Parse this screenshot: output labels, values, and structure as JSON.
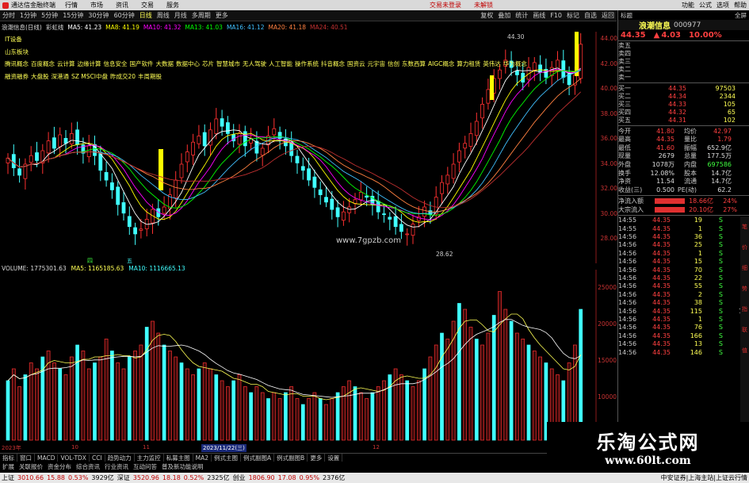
{
  "menubar": {
    "app_title": "通达信金融终端",
    "items": [
      "行情",
      "市场",
      "资讯",
      "交易",
      "服务"
    ],
    "alerts": [
      "交易未登录",
      "未解锁"
    ],
    "right_items": [
      "功能",
      "公式",
      "选项",
      "帮助"
    ]
  },
  "toolbar": {
    "items": [
      "分时",
      "1分钟",
      "5分钟",
      "15分钟",
      "30分钟",
      "60分钟",
      "日线",
      "周线",
      "月线",
      "多周期",
      "更多"
    ],
    "active": "日线",
    "tools": [
      "复权",
      "叠加",
      "统计",
      "画线",
      "F10",
      "标记",
      "自选",
      "返回"
    ]
  },
  "chart_header": {
    "stock": "浪潮信息(日线)",
    "indicator": "彩虹线",
    "ma": [
      {
        "label": "MA5: 41.23",
        "color": "#ffffff"
      },
      {
        "label": "MA8: 41.19",
        "color": "#ffff00"
      },
      {
        "label": "MA10: 41.32",
        "color": "#ff00ff"
      },
      {
        "label": "MA13: 41.03",
        "color": "#00ff00"
      },
      {
        "label": "MA16: 41.12",
        "color": "#40c0ff"
      },
      {
        "label": "MA20: 41.18",
        "color": "#ff8040"
      },
      {
        "label": "MA24: 40.51",
        "color": "#c03030"
      }
    ]
  },
  "concepts": [
    [
      "IT设备"
    ],
    [
      "山东板块"
    ],
    [
      "腾讯概念",
      "百度概念",
      "云计算",
      "边缘计算",
      "信息安全",
      "国产软件",
      "大数据",
      "数据中心",
      "芯片",
      "智慧城市",
      "无人驾驶",
      "人工智能",
      "操作系统",
      "抖音概念",
      "国资云",
      "元宇宙",
      "信创",
      "东数西算",
      "AIGC概念",
      "算力租赁",
      "英伟达",
      "华为概念"
    ],
    [
      "融资融券",
      "大盘股",
      "深港通",
      "SZ MSCI中盘",
      "昨成交20",
      "丰周期股"
    ]
  ],
  "price_annotations": {
    "high": "44.30",
    "low": "28.62"
  },
  "right_axis": [
    "44.00",
    "42.00",
    "40.00",
    "38.00",
    "36.00",
    "34.00",
    "32.00",
    "30.00",
    "28.00"
  ],
  "vol_header": {
    "label": "VOLUME: 1775301.63",
    "ma5": "MA5: 1165185.63",
    "ma10": "MA10: 1116665.13"
  },
  "vol_axis": [
    "25000",
    "20000",
    "15000",
    "10000",
    "5000"
  ],
  "vol_axis_unit": "×10",
  "markers": [
    "四",
    "五"
  ],
  "watermark_site": "www.7gpzb.com",
  "date_labels": [
    "2023年",
    "10",
    "11",
    "2023/11/22(三)",
    "12"
  ],
  "bottom_tabs": [
    "指标",
    "窗口",
    "MACD",
    "VOL-TDX",
    "CCI",
    "趋势动力",
    "主力监控",
    "私募主图",
    "MA2",
    "例式主图",
    "例式副图A",
    "例式副图B",
    "更多",
    "设置"
  ],
  "bottom_tabs2": [
    "扩展",
    "关联报价",
    "资金分布",
    "综合资讯",
    "行业资讯",
    "互动问答",
    "普及新功能说明"
  ],
  "status": {
    "items": [
      {
        "label": "上证",
        "val": "3010.66",
        "chg": "15.88",
        "pct": "0.53%",
        "amt": "3929亿"
      },
      {
        "label": "深证",
        "val": "3520.96",
        "chg": "18.18",
        "pct": "0.52%",
        "amt": "2325亿"
      },
      {
        "label": "创业",
        "val": "1806.90",
        "chg": "17.08",
        "pct": "0.95%",
        "amt": "2376亿"
      }
    ],
    "broker": "中安证券|上海主站|上证云行情"
  },
  "quote": {
    "buttons": [
      "标题",
      "全屏"
    ],
    "name": "浪潮信息",
    "code": "000977",
    "price": "44.35",
    "change": "4.03",
    "pct": "10.00%",
    "asks": [
      {
        "l": "卖五",
        "p": "",
        "v": ""
      },
      {
        "l": "卖四",
        "p": "",
        "v": ""
      },
      {
        "l": "卖三",
        "p": "",
        "v": ""
      },
      {
        "l": "卖二",
        "p": "",
        "v": ""
      },
      {
        "l": "卖一",
        "p": "",
        "v": ""
      }
    ],
    "bids": [
      {
        "l": "买一",
        "p": "44.35",
        "v": "97503"
      },
      {
        "l": "买二",
        "p": "44.34",
        "v": "2344"
      },
      {
        "l": "买三",
        "p": "44.33",
        "v": "105"
      },
      {
        "l": "买四",
        "p": "44.32",
        "v": "65"
      },
      {
        "l": "买五",
        "p": "44.31",
        "v": "102"
      }
    ],
    "stats": [
      {
        "k": "今开",
        "v": "41.80",
        "k2": "均价",
        "v2": "42.97"
      },
      {
        "k": "最高",
        "v": "44.35",
        "k2": "量比",
        "v2": "1.79"
      },
      {
        "k": "最低",
        "v": "41.60",
        "k2": "振幅",
        "v2": "652.9亿"
      },
      {
        "k": "现量",
        "v": "2679",
        "k2": "总量",
        "v2": "177.5万"
      },
      {
        "k": "外盘",
        "v": "1078万",
        "k2": "内盘",
        "v2": "697586"
      },
      {
        "k": "换手",
        "v": "12.08%",
        "k2": "股本",
        "v2": "14.7亿"
      },
      {
        "k": "净资",
        "v": "11.54",
        "k2": "流通",
        "v2": "14.7亿"
      },
      {
        "k": "收益(三)",
        "v": "0.500",
        "k2": "PE(动)",
        "v2": "62.2"
      }
    ],
    "flows": [
      {
        "k": "净流入额",
        "v": "18.66亿",
        "pct": "24%"
      },
      {
        "k": "大宗流入",
        "v": "20.10亿",
        "pct": "27%"
      }
    ],
    "ticks": [
      {
        "t": "14:55",
        "p": "44.35",
        "v": "19",
        "d": "S",
        "n": "1"
      },
      {
        "t": "14:55",
        "p": "44.35",
        "v": "1",
        "d": "S",
        "n": "1"
      },
      {
        "t": "14:56",
        "p": "44.35",
        "v": "36",
        "d": "S",
        "n": "2"
      },
      {
        "t": "14:56",
        "p": "44.35",
        "v": "25",
        "d": "S",
        "n": "3"
      },
      {
        "t": "14:56",
        "p": "44.35",
        "v": "1",
        "d": "S",
        "n": "1"
      },
      {
        "t": "14:56",
        "p": "44.35",
        "v": "15",
        "d": "S",
        "n": "1"
      },
      {
        "t": "14:56",
        "p": "44.35",
        "v": "70",
        "d": "S",
        "n": "8"
      },
      {
        "t": "14:56",
        "p": "44.35",
        "v": "22",
        "d": "S",
        "n": "3"
      },
      {
        "t": "14:56",
        "p": "44.35",
        "v": "55",
        "d": "S",
        "n": "4"
      },
      {
        "t": "14:56",
        "p": "44.35",
        "v": "2",
        "d": "S",
        "n": "2"
      },
      {
        "t": "14:56",
        "p": "44.35",
        "v": "38",
        "d": "S",
        "n": "4"
      },
      {
        "t": "14:56",
        "p": "44.35",
        "v": "115",
        "d": "S",
        "n": "10"
      },
      {
        "t": "14:56",
        "p": "44.35",
        "v": "1",
        "d": "S",
        "n": "1"
      },
      {
        "t": "14:56",
        "p": "44.35",
        "v": "76",
        "d": "S",
        "n": "3"
      },
      {
        "t": "14:56",
        "p": "44.35",
        "v": "166",
        "d": "S",
        "n": "7"
      },
      {
        "t": "14:56",
        "p": "44.35",
        "v": "13",
        "d": "S",
        "n": "3"
      },
      {
        "t": "14:56",
        "p": "44.35",
        "v": "146",
        "d": "S",
        "n": "5"
      }
    ],
    "side": [
      "笔",
      "价",
      "细",
      "势",
      "指",
      "联",
      "值"
    ]
  },
  "logo": {
    "line1": "乐淘公式网",
    "line2": "www.60lt.com"
  }
}
